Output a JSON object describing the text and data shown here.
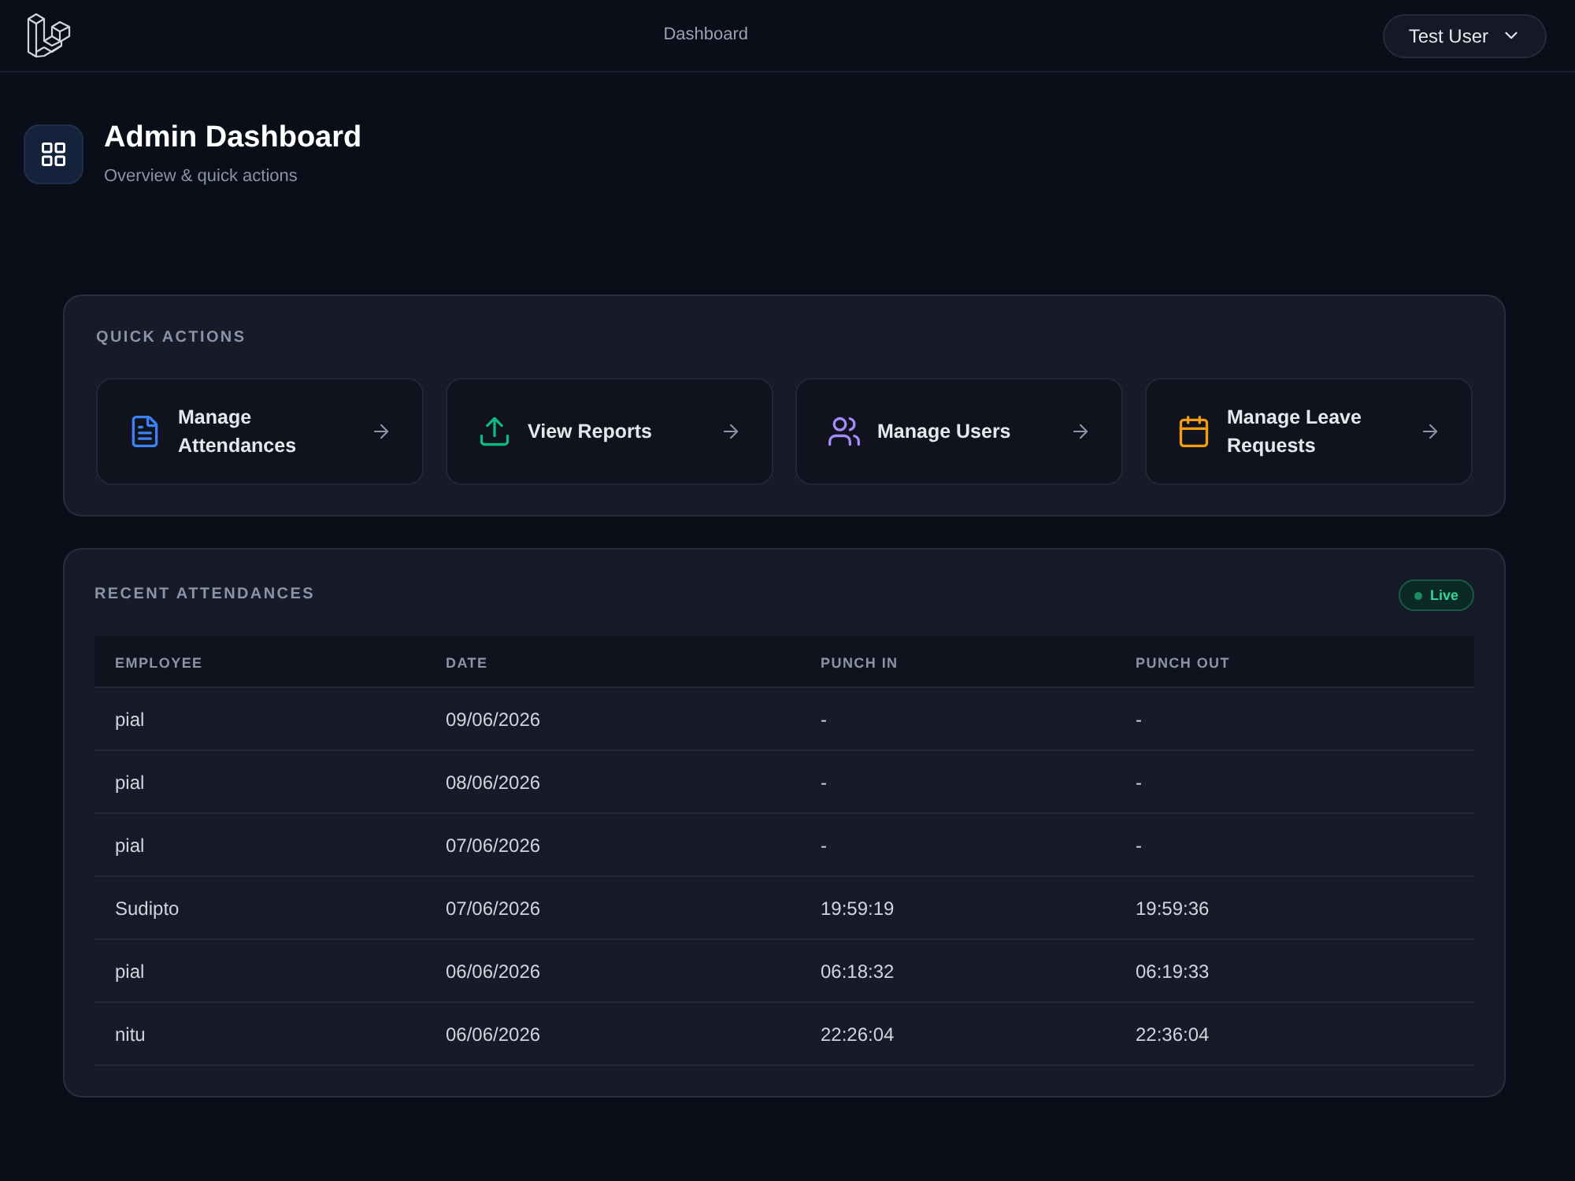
{
  "header": {
    "nav_link": "Dashboard",
    "user_menu": {
      "label": "Test User"
    }
  },
  "page_header": {
    "title": "Admin Dashboard",
    "subtitle": "Overview & quick actions"
  },
  "quick_actions": {
    "heading": "QUICK ACTIONS",
    "items": [
      {
        "label": "Manage Attendances",
        "color": "#3b82f6"
      },
      {
        "label": "View Reports",
        "color": "#10b981"
      },
      {
        "label": "Manage Users",
        "color": "#a78bfa"
      },
      {
        "label": "Manage Leave Requests",
        "color": "#f59e0b"
      }
    ]
  },
  "recent_attendances": {
    "heading": "RECENT ATTENDANCES",
    "badge": "Live",
    "table": {
      "columns": [
        "EMPLOYEE",
        "DATE",
        "PUNCH IN",
        "PUNCH OUT"
      ],
      "rows": [
        [
          "pial",
          "09/06/2026",
          "-",
          "-"
        ],
        [
          "pial",
          "08/06/2026",
          "-",
          "-"
        ],
        [
          "pial",
          "07/06/2026",
          "-",
          "-"
        ],
        [
          "Sudipto",
          "07/06/2026",
          "19:59:19",
          "19:59:36"
        ],
        [
          "pial",
          "06/06/2026",
          "06:18:32",
          "06:19:33"
        ],
        [
          "nitu",
          "06/06/2026",
          "22:26:04",
          "22:36:04"
        ]
      ]
    }
  }
}
